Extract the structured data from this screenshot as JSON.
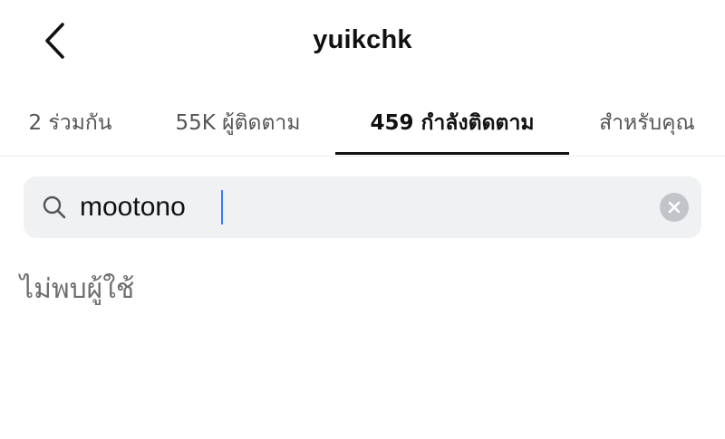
{
  "header": {
    "back_icon": "chevron-left-icon",
    "username": "yuikchk"
  },
  "tabs": [
    {
      "label": "2 ร่วมกัน",
      "active": false
    },
    {
      "label": "55K ผู้ติดตาม",
      "active": false
    },
    {
      "label": "459 กำลังติดตาม",
      "active": true
    },
    {
      "label": "สำหรับคุณ",
      "active": false
    }
  ],
  "search": {
    "icon": "search-icon",
    "value": "mootono",
    "clear_icon": "clear-icon"
  },
  "results": {
    "empty_message": "ไม่พบผู้ใช้"
  },
  "colors": {
    "search_background": "#eff1f3",
    "active_tab_indicator": "#111111",
    "caret": "#3a7bff"
  }
}
